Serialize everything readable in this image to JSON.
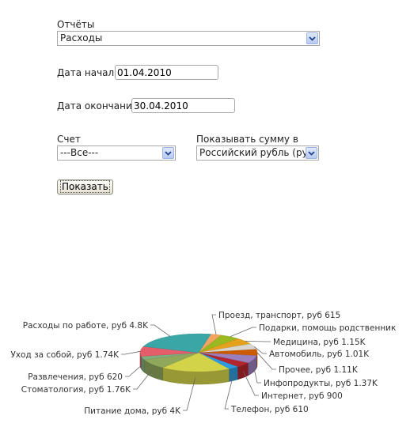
{
  "form": {
    "reports_label": "Отчёты",
    "reports_value": "Расходы",
    "start_label": "Дата начала",
    "start_value": "01.04.2010",
    "end_label": "Дата окончания",
    "end_value": "30.04.2010",
    "account_label": "Счет",
    "account_value": "---Все---",
    "currency_label": "Показывать сумму в",
    "currency_value": "Российский рубль (руб)",
    "show_button": "Показать"
  },
  "chart_data": {
    "type": "pie",
    "style": "3d",
    "slices": [
      {
        "label": "Проезд, транспорт, руб 615",
        "value": 615,
        "color": "#f4a460"
      },
      {
        "label": "Подарки, помощь родственник",
        "value": 1150,
        "color": "#9ab81f"
      },
      {
        "label": "Медицина, руб 1.15K",
        "value": 1150,
        "color": "#e4a21c"
      },
      {
        "label": "Автомобиль, руб 1.01K",
        "value": 1010,
        "color": "#d8d6ce"
      },
      {
        "label": "Прочее, руб 1.11K",
        "value": 1110,
        "color": "#cc5b00"
      },
      {
        "label": "Инфопродукты, руб 1.37K",
        "value": 1370,
        "color": "#9b7fbd"
      },
      {
        "label": "Интернет, руб 900",
        "value": 900,
        "color": "#b3262d"
      },
      {
        "label": "Телефон, руб 610",
        "value": 610,
        "color": "#2e9ae0"
      },
      {
        "label": "Питание дома, руб 4K",
        "value": 4000,
        "color": "#d3d34a"
      },
      {
        "label": "Стоматология, руб 1.76K",
        "value": 1760,
        "color": "#8fa85c"
      },
      {
        "label": "Развлечения, руб 620",
        "value": 620,
        "color": "#7fae7f"
      },
      {
        "label": "Уход за собой, руб 1.74K",
        "value": 1740,
        "color": "#e35d6a"
      },
      {
        "label": "Расходы по работе, руб 4.8K",
        "value": 4800,
        "color": "#3aa6a6"
      }
    ]
  }
}
